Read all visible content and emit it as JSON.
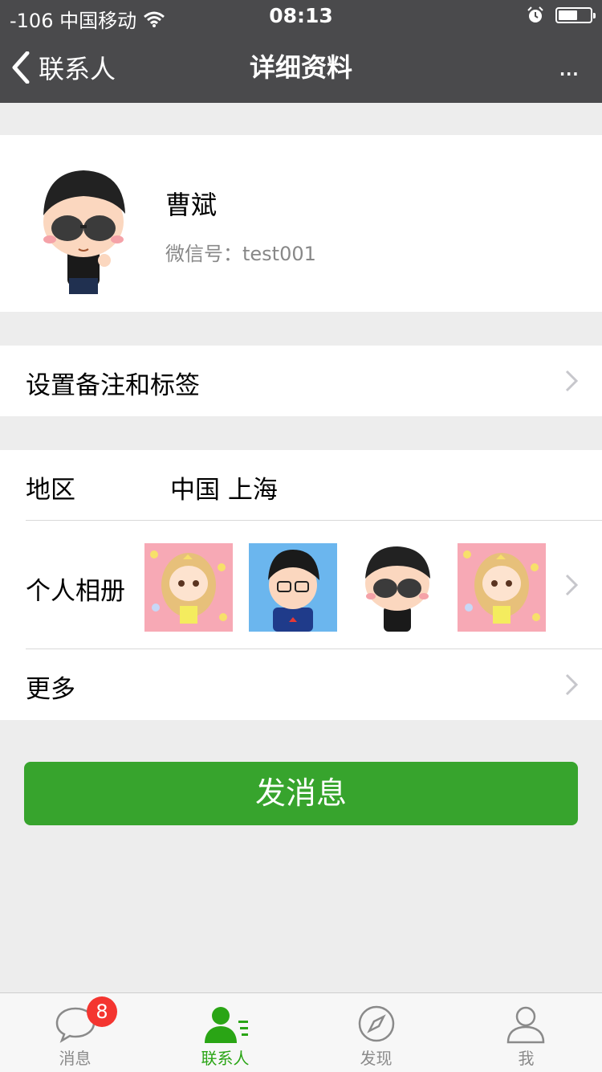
{
  "status_bar": {
    "carrier": "-106 中国移动",
    "time": "08:13",
    "battery_level": 0.62,
    "icons": [
      "wifi-icon",
      "alarm-icon",
      "battery-icon"
    ]
  },
  "nav": {
    "back_label": "联系人",
    "title": "详细资料",
    "more_label": "..."
  },
  "profile": {
    "name": "曹斌",
    "wechat_id": "微信号：test001"
  },
  "settings_row": {
    "label": "设置备注和标签"
  },
  "region_row": {
    "label": "地区",
    "value": "中国 上海"
  },
  "album_row": {
    "label": "个人相册",
    "thumbnails": [
      "girl-avatar",
      "boy-glasses-avatar",
      "boy-sunglasses-avatar",
      "girl-avatar"
    ]
  },
  "more_row": {
    "label": "更多"
  },
  "send_button": {
    "label": "发消息"
  },
  "tabbar": {
    "tabs": [
      {
        "label": "消息",
        "icon": "chat-bubble-icon",
        "badge": "8"
      },
      {
        "label": "联系人",
        "icon": "contacts-icon",
        "active": true
      },
      {
        "label": "发现",
        "icon": "compass-icon"
      },
      {
        "label": "我",
        "icon": "person-icon"
      }
    ]
  },
  "colors": {
    "nav_bg": "#4a4a4c",
    "accent_green": "#37a42d",
    "tab_active": "#2aa515",
    "badge_red": "#f43530",
    "page_bg": "#ededed"
  }
}
